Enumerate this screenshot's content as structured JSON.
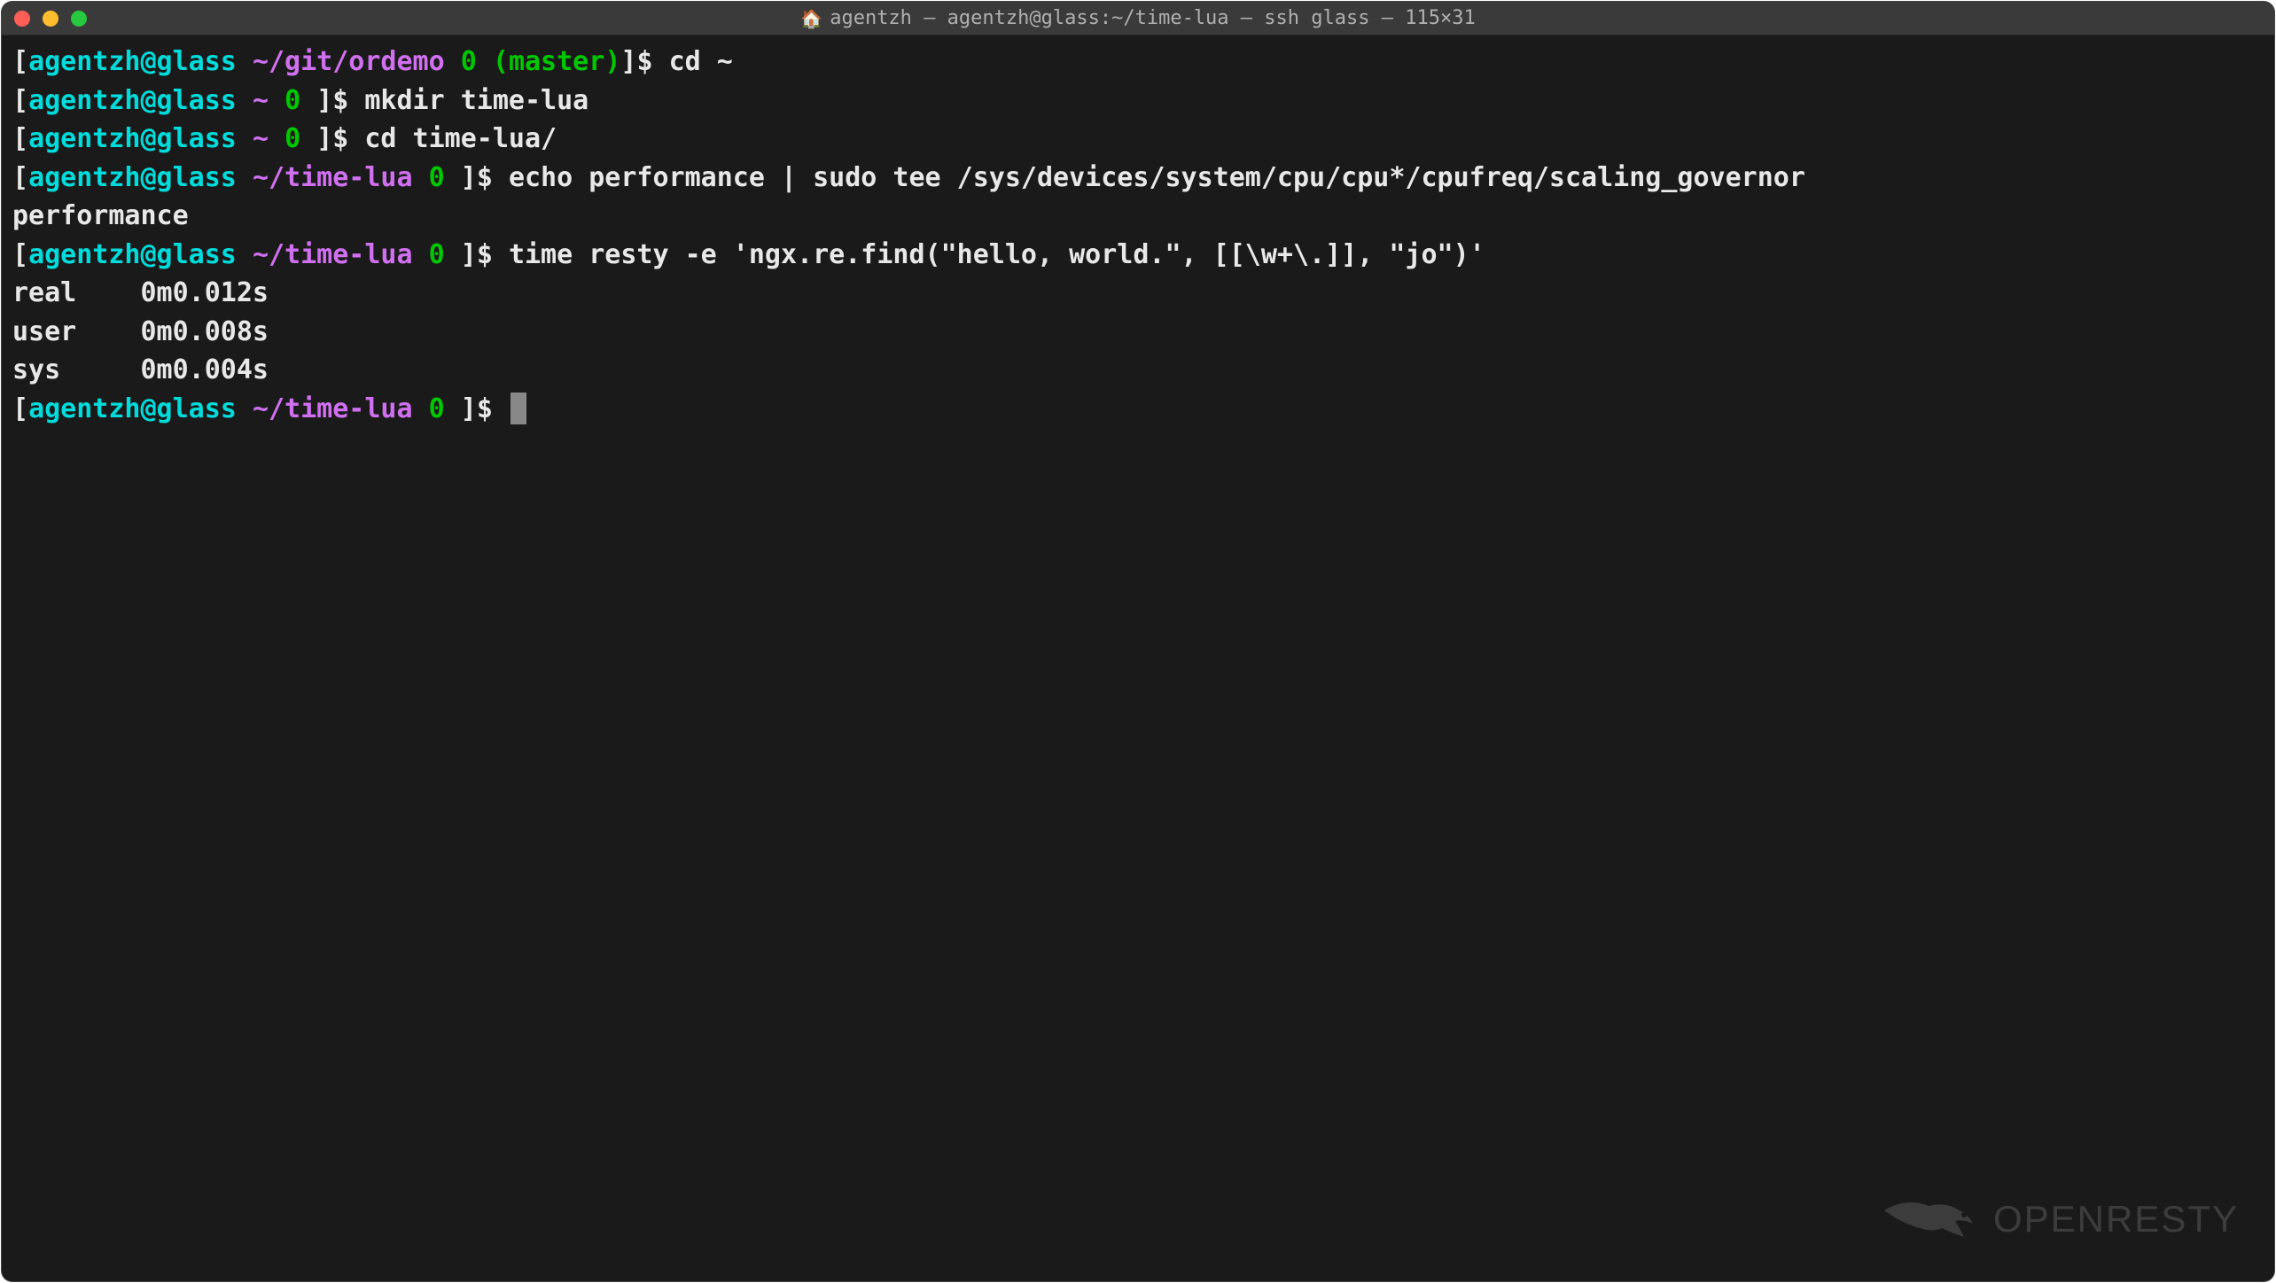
{
  "window": {
    "title": "agentzh — agentzh@glass:~/time-lua — ssh glass — 115×31"
  },
  "lines": {
    "l1": {
      "bracket_open": "[",
      "user_host": "agentzh@glass",
      "path": "~/git/ordemo",
      "exit_code": "0",
      "branch_open": "(",
      "branch": "master",
      "branch_close": ")",
      "bracket_close": "]",
      "dollar": "$",
      "command": "cd ~"
    },
    "l2": {
      "bracket_open": "[",
      "user_host": "agentzh@glass",
      "path": "~",
      "exit_code": "0",
      "bracket_close": "]",
      "dollar": "$",
      "command": "mkdir time-lua"
    },
    "l3": {
      "bracket_open": "[",
      "user_host": "agentzh@glass",
      "path": "~",
      "exit_code": "0",
      "bracket_close": "]",
      "dollar": "$",
      "command": "cd time-lua/"
    },
    "l4": {
      "bracket_open": "[",
      "user_host": "agentzh@glass",
      "path": "~/time-lua",
      "exit_code": "0",
      "bracket_close": "]",
      "dollar": "$",
      "command": "echo performance | sudo tee /sys/devices/system/cpu/cpu*/cpufreq/scaling_governor"
    },
    "l5": {
      "output": "performance"
    },
    "l6": {
      "bracket_open": "[",
      "user_host": "agentzh@glass",
      "path": "~/time-lua",
      "exit_code": "0",
      "bracket_close": "]",
      "dollar": "$",
      "command": "time resty -e 'ngx.re.find(\"hello, world.\", [[\\w+\\.]], \"jo\")'"
    },
    "l7": {
      "output": ""
    },
    "l8": {
      "output": "real    0m0.012s"
    },
    "l9": {
      "output": "user    0m0.008s"
    },
    "l10": {
      "output": "sys     0m0.004s"
    },
    "l11": {
      "bracket_open": "[",
      "user_host": "agentzh@glass",
      "path": "~/time-lua",
      "exit_code": "0",
      "bracket_close": "]",
      "dollar": "$"
    }
  },
  "watermark": {
    "text_open": "OPEN",
    "text_resty": "RESTY"
  }
}
